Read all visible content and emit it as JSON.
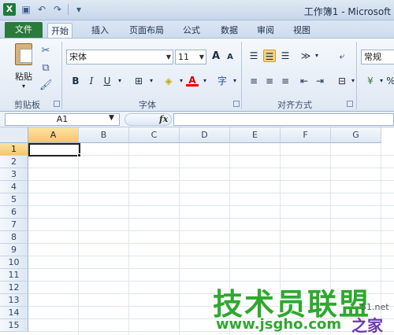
{
  "window": {
    "title": "工作簿1 - Microsoft"
  },
  "qat": {
    "icons": [
      "excel-logo",
      "save-icon",
      "undo-icon",
      "redo-icon",
      "customize-qat-icon"
    ]
  },
  "tabs": {
    "file": "文件",
    "items": [
      {
        "label": "开始",
        "active": true
      },
      {
        "label": "插入",
        "active": false
      },
      {
        "label": "页面布局",
        "active": false
      },
      {
        "label": "公式",
        "active": false
      },
      {
        "label": "数据",
        "active": false
      },
      {
        "label": "审阅",
        "active": false
      },
      {
        "label": "视图",
        "active": false
      }
    ]
  },
  "ribbon": {
    "clipboard": {
      "paste_label": "粘贴",
      "group_label": "剪贴板"
    },
    "font": {
      "font_name": "宋体",
      "font_size": "11",
      "bold": "B",
      "italic": "I",
      "underline": "U",
      "grow": "A",
      "shrink": "A",
      "phonetic": "字",
      "group_label": "字体"
    },
    "alignment": {
      "group_label": "对齐方式"
    },
    "number": {
      "format": "常规"
    }
  },
  "formula_bar": {
    "name_box": "A1",
    "fx": "fx",
    "value": ""
  },
  "grid": {
    "columns": [
      "A",
      "B",
      "C",
      "D",
      "E",
      "F",
      "G"
    ],
    "rows": [
      "1",
      "2",
      "3",
      "4",
      "5",
      "6",
      "7",
      "8",
      "9",
      "10",
      "11",
      "12",
      "13",
      "14",
      "15"
    ],
    "active_cell": "A1"
  },
  "watermark": {
    "main": "技术员联盟",
    "url": "www.jsgho.com",
    "home": "之家",
    "tail": "51.net"
  }
}
